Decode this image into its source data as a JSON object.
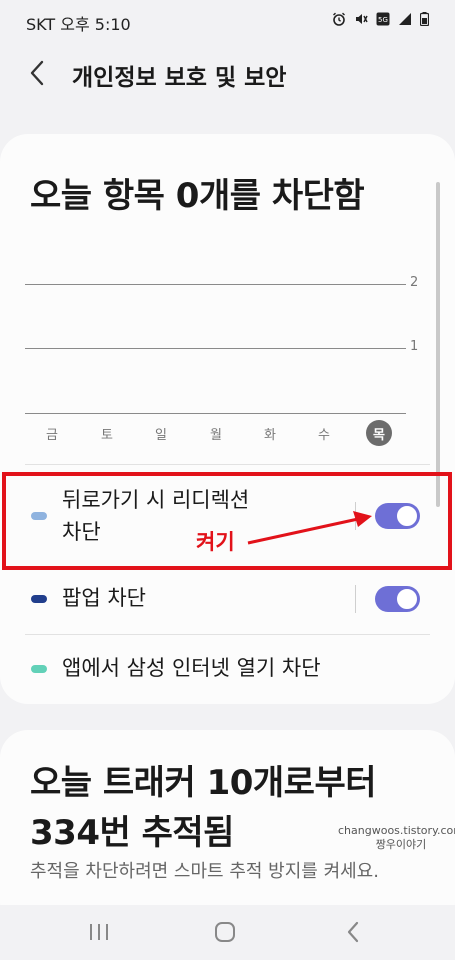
{
  "status_bar": {
    "carrier_time": "SKT 오후 5:10",
    "icons": [
      "alarm-icon",
      "mute-icon",
      "5g-signal-icon",
      "battery-icon"
    ]
  },
  "header": {
    "back_icon": "chevron-left",
    "title": "개인정보 보호 및 보안"
  },
  "blocked_card": {
    "title": "오늘 항목 0개를 차단함",
    "chart_data": {
      "type": "bar",
      "categories": [
        "금",
        "토",
        "일",
        "월",
        "화",
        "수",
        "목"
      ],
      "series": [
        {
          "values": [
            0,
            0,
            0,
            0,
            0,
            0,
            0
          ]
        }
      ],
      "y_ticks": [
        "2",
        "1"
      ],
      "ylim": [
        0,
        2
      ],
      "highlighted_category": "목"
    },
    "settings": [
      {
        "label_line1": "뒤로가기 시 리디렉션",
        "label_line2": "차단",
        "color": "#8fb3df",
        "enabled": true
      },
      {
        "label": "팝업 차단",
        "color": "#213e8c",
        "enabled": true
      },
      {
        "label": "앱에서 삼성 인터넷 열기 차단",
        "color": "#62d1b8"
      }
    ]
  },
  "annotation": {
    "text": "켜기",
    "color": "#e2121a"
  },
  "tracker_card": {
    "title": "오늘 트래커 10개로부터 334번 추적됨",
    "subtitle": "추적을 차단하려면 스마트 추적 방지를 켜세요."
  },
  "watermark": {
    "line1": "changwoos.tistory.com",
    "line2": "짱우이야기"
  },
  "colors": {
    "accent": "#6e6fd6",
    "background": "#f2f2f4"
  }
}
